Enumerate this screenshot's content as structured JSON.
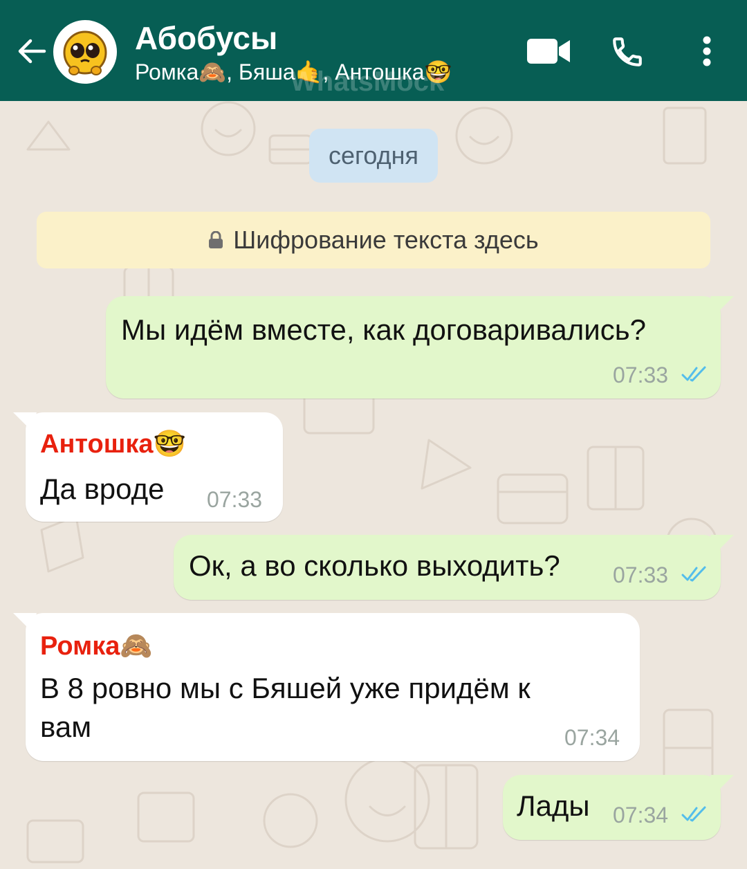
{
  "header": {
    "title": "Абобусы",
    "members": "Ромка🙈, Бяша🤙, Антошка🤓",
    "watermark": "WhatsMock",
    "icons": [
      "back-arrow-icon",
      "video-call-icon",
      "phone-icon",
      "more-options-icon"
    ]
  },
  "chat": {
    "date_chip": "сегодня",
    "encryption_notice": "Шифрование текста здесь",
    "messages": [
      {
        "direction": "out",
        "text": "Мы идём вместе, как договаривались?",
        "time": "07:33",
        "status": "read"
      },
      {
        "direction": "in",
        "sender": "Антошка🤓",
        "text": "Да вроде",
        "time": "07:33"
      },
      {
        "direction": "out",
        "text": "Ок, а во сколько выходить?",
        "time": "07:33",
        "status": "read"
      },
      {
        "direction": "in",
        "sender": "Ромка🙈",
        "text_line1": "В 8 ровно мы с Бяшей уже придём к",
        "text_line2": "вам",
        "time": "07:34"
      },
      {
        "direction": "out",
        "text": "Лады",
        "time": "07:34",
        "status": "read"
      }
    ]
  },
  "colors": {
    "header": "#075e54",
    "outgoing_bubble": "#e2f7cb",
    "incoming_bubble": "#ffffff",
    "sender_name": "#e8210e",
    "read_ticks": "#53bdeb",
    "date_chip": "#d0e4f3",
    "encryption_notice": "#fbf1c9"
  }
}
